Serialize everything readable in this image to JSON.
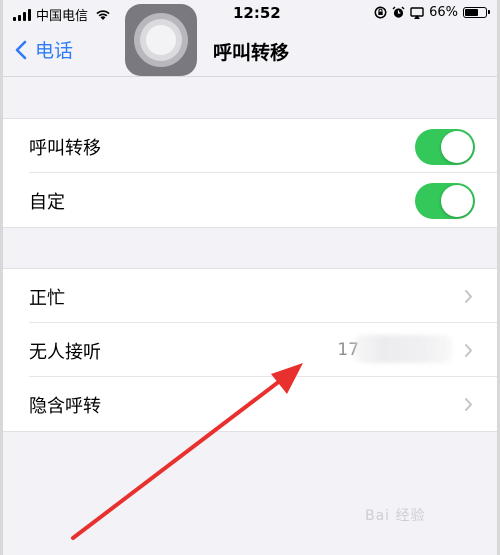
{
  "status_bar": {
    "carrier": "中国电信",
    "time": "12:52",
    "battery_percent": "66%",
    "battery_level": 0.66,
    "icons": [
      "signal-icon",
      "wifi-icon",
      "rotation-lock-icon",
      "alarm-icon",
      "screen-mirroring-icon",
      "battery-icon"
    ]
  },
  "nav": {
    "back_label": "电话",
    "title": "呼叫转移"
  },
  "settings": {
    "toggles": [
      {
        "label": "呼叫转移",
        "on": true
      },
      {
        "label": "自定",
        "on": true
      }
    ],
    "options": [
      {
        "label": "正忙",
        "value": ""
      },
      {
        "label": "无人接听",
        "value": "17"
      },
      {
        "label": "隐含呼转",
        "value": ""
      }
    ]
  },
  "annotation": {
    "arrow_color": "#e8312f"
  },
  "colors": {
    "accent": "#2f7cf6",
    "toggle_on": "#34c759",
    "background": "#f2f2f7"
  },
  "watermark": "Bai 经验"
}
